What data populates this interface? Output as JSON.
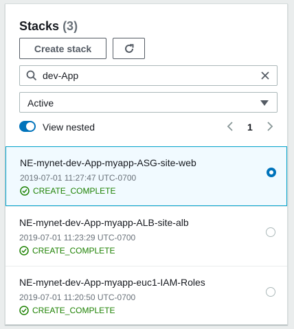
{
  "header": {
    "title": "Stacks",
    "count": "(3)"
  },
  "toolbar": {
    "create_label": "Create stack"
  },
  "search": {
    "value": "dev-App"
  },
  "filter": {
    "selected": "Active"
  },
  "nested_toggle": {
    "label": "View nested",
    "on": true
  },
  "pagination": {
    "page": "1"
  },
  "stacks": [
    {
      "name": "NE-mynet-dev-App-myapp-ASG-site-web",
      "time": "2019-07-01 11:27:47 UTC-0700",
      "status": "CREATE_COMPLETE",
      "selected": true
    },
    {
      "name": "NE-mynet-dev-App-myapp-ALB-site-alb",
      "time": "2019-07-01 11:23:29 UTC-0700",
      "status": "CREATE_COMPLETE",
      "selected": false
    },
    {
      "name": "NE-mynet-dev-App-myapp-euc1-IAM-Roles",
      "time": "2019-07-01 11:20:50 UTC-0700",
      "status": "CREATE_COMPLETE",
      "selected": false
    }
  ],
  "colors": {
    "accent": "#0073bb",
    "success": "#1d8102",
    "selected_bg": "#f1faff",
    "selected_border": "#00a1c9"
  }
}
